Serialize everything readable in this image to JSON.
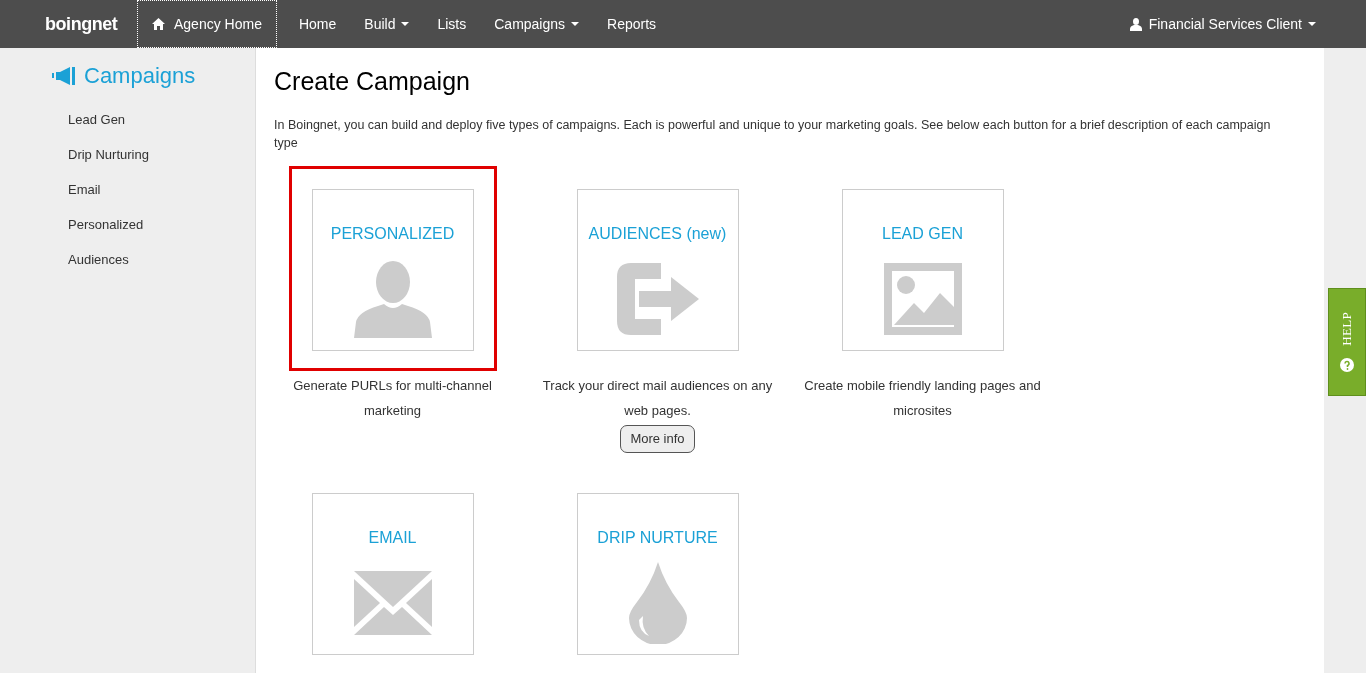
{
  "navbar": {
    "logo": "boingnet",
    "agency_home": "Agency Home",
    "items": [
      {
        "label": "Home",
        "dropdown": false
      },
      {
        "label": "Build",
        "dropdown": true
      },
      {
        "label": "Lists",
        "dropdown": false
      },
      {
        "label": "Campaigns",
        "dropdown": true
      },
      {
        "label": "Reports",
        "dropdown": false
      }
    ],
    "user": "Financial Services Client"
  },
  "sidebar": {
    "title": "Campaigns",
    "items": [
      "Lead Gen",
      "Drip Nurturing",
      "Email",
      "Personalized",
      "Audiences"
    ]
  },
  "page": {
    "title": "Create Campaign",
    "intro": "In Boingnet, you can build and deploy five types of campaigns. Each is powerful and unique to your marketing goals. See below each button for a brief description of each campaign type",
    "cards": [
      {
        "title": "PERSONALIZED",
        "description": "Generate PURLs for multi-channel marketing",
        "selected": true
      },
      {
        "title": "AUDIENCES (new)",
        "description": "Track your direct mail audiences on any web pages.",
        "selected": false,
        "button": "More info"
      },
      {
        "title": "LEAD GEN",
        "description": "Create mobile friendly landing pages and microsites",
        "selected": false
      },
      {
        "title": "EMAIL",
        "selected": false
      },
      {
        "title": "DRIP NURTURE",
        "selected": false
      }
    ]
  },
  "help_tab": {
    "label": "HELP"
  }
}
